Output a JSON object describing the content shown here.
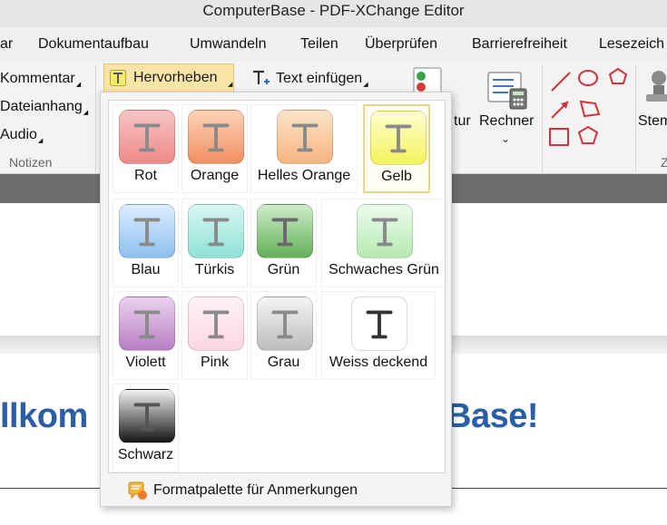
{
  "window": {
    "title": "ComputerBase - PDF-XChange Editor"
  },
  "menu": [
    {
      "name": "ar"
    },
    {
      "name": "Dokumentaufbau"
    },
    {
      "name": "Umwandeln"
    },
    {
      "name": "Teilen"
    },
    {
      "name": "Überprüfen"
    },
    {
      "name": "Barrierefreiheit"
    },
    {
      "name": "Lesezeich"
    }
  ],
  "ribbon": {
    "notes_group": {
      "kommentar": "Kommentar",
      "dateianhang": "Dateianhang",
      "audio": "Audio",
      "label": "Notizen"
    },
    "hervorheben": "Hervorheben",
    "text_einfuegen": "Text einfügen",
    "tur": "tur",
    "rechner": "Rechner",
    "stem": "Stem",
    "z": "Z"
  },
  "document": {
    "headline_left": "llkom",
    "headline_right": "Base!"
  },
  "dropdown": {
    "styles": [
      {
        "label": "Rot",
        "top": "#f8c4c4",
        "bottom": "#ee8a8a",
        "glyph": "#8a8a8a"
      },
      {
        "label": "Orange",
        "top": "#fbd2b8",
        "bottom": "#f29060",
        "glyph": "#8a8a8a"
      },
      {
        "label": "Helles Orange",
        "top": "#fde4cc",
        "bottom": "#f7b47e",
        "glyph": "#8a8a8a"
      },
      {
        "label": "Gelb",
        "top": "#ffffd0",
        "bottom": "#f4f35a",
        "glyph": "#8a8a8a"
      },
      {
        "label": "Blau",
        "top": "#dcecff",
        "bottom": "#8cc0f0",
        "glyph": "#8a8a8a"
      },
      {
        "label": "Türkis",
        "top": "#d8f6f2",
        "bottom": "#8fe2d6",
        "glyph": "#8a8a8a"
      },
      {
        "label": "Grün",
        "top": "#cfeccc",
        "bottom": "#62b058",
        "glyph": "#6a6a6a"
      },
      {
        "label": "Schwaches Grün",
        "top": "#eefbed",
        "bottom": "#b6eab2",
        "glyph": "#8a8a8a"
      },
      {
        "label": "Violett",
        "top": "#ead2ee",
        "bottom": "#b87ec4",
        "glyph": "#8a8a8a"
      },
      {
        "label": "Pink",
        "top": "#fff2f6",
        "bottom": "#fcd6e2",
        "glyph": "#8a8a8a"
      },
      {
        "label": "Grau",
        "top": "#f4f4f4",
        "bottom": "#bdbdbd",
        "glyph": "#8a8a8a"
      },
      {
        "label": "Weiss deckend",
        "top": "#ffffff",
        "bottom": "#ffffff",
        "glyph": "#333333"
      },
      {
        "label": "Schwarz",
        "top": "#f2f2f2",
        "bottom": "#141414",
        "glyph": "#555555"
      }
    ],
    "selected": "Gelb",
    "footer": "Formatpalette für Anmerkungen"
  }
}
